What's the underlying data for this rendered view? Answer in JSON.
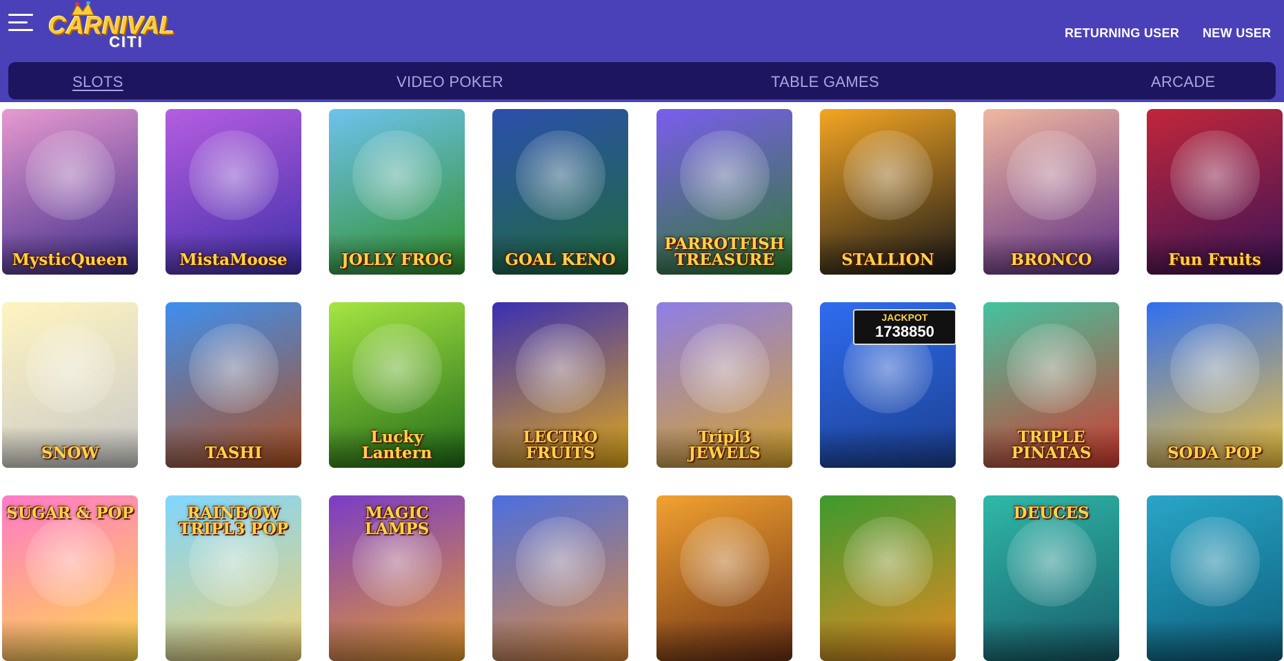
{
  "header": {
    "logo_line1": "CARNIVAL",
    "logo_line2": "CITI",
    "returning_user": "RETURNING USER",
    "new_user": "NEW USER",
    "menu_icon": "hamburger-menu-icon"
  },
  "nav": {
    "tabs": [
      {
        "label": "SLOTS",
        "active": true
      },
      {
        "label": "VIDEO POKER",
        "active": false
      },
      {
        "label": "TABLE GAMES",
        "active": false
      },
      {
        "label": "ARCADE",
        "active": false
      }
    ]
  },
  "games": [
    {
      "title": "MysticQueen",
      "colors": [
        "#e89ad0",
        "#3b2a8a"
      ]
    },
    {
      "title": "MistaMoose",
      "colors": [
        "#b65de0",
        "#3f2fa8"
      ]
    },
    {
      "title": "JOLLY FROG",
      "colors": [
        "#6ec2ee",
        "#2f8f27"
      ]
    },
    {
      "title": "GOAL KENO",
      "colors": [
        "#2b4fae",
        "#1f6b39"
      ]
    },
    {
      "title": "PARROTFISH TREASURE",
      "colors": [
        "#7b5cf0",
        "#2e7d2c"
      ]
    },
    {
      "title": "STALLION",
      "colors": [
        "#f5a623",
        "#181818"
      ]
    },
    {
      "title": "BRONCO",
      "colors": [
        "#f0b8a0",
        "#5b2c86"
      ]
    },
    {
      "title": "Fun Fruits",
      "colors": [
        "#c2263a",
        "#3a1357"
      ]
    },
    {
      "title": "SNOW",
      "colors": [
        "#fff4c0",
        "#c9c9c9"
      ]
    },
    {
      "title": "TASHI",
      "colors": [
        "#3d8ff0",
        "#b1501d"
      ]
    },
    {
      "title": "Lucky Lantern",
      "colors": [
        "#a6e542",
        "#1f6a18"
      ]
    },
    {
      "title": "LECTRO FRUITS",
      "colors": [
        "#3a2fb3",
        "#e0a81a"
      ]
    },
    {
      "title": "Tripl3 JEWELS",
      "colors": [
        "#8d7ee6",
        "#d8a42a"
      ]
    },
    {
      "title": "1738850",
      "colors": [
        "#2f6cf0",
        "#1b3f8f"
      ],
      "jackpot_label": "JACKPOT"
    },
    {
      "title": "TRIPLE PINATAS",
      "colors": [
        "#43c3a0",
        "#d23a2e"
      ]
    },
    {
      "title": "SODA POP",
      "colors": [
        "#2f6ff0",
        "#f4c23a"
      ]
    },
    {
      "title": "SUGAR & POP",
      "colors": [
        "#ff7ac9",
        "#ffd84a"
      ]
    },
    {
      "title": "RAINBOW TRIPL3 POP",
      "colors": [
        "#7fd6ff",
        "#f0d070"
      ]
    },
    {
      "title": "MAGIC LAMPS",
      "colors": [
        "#7a3cc8",
        "#e59a2b"
      ]
    },
    {
      "title": "",
      "colors": [
        "#4b6ee0",
        "#e08a3a"
      ]
    },
    {
      "title": "",
      "colors": [
        "#f2a230",
        "#6b2f14"
      ]
    },
    {
      "title": "",
      "colors": [
        "#3c9a2e",
        "#e58a22"
      ]
    },
    {
      "title": "DEUCES",
      "colors": [
        "#2fb9a8",
        "#175b6a"
      ]
    },
    {
      "title": "",
      "colors": [
        "#29a6c8",
        "#0d5e7b"
      ]
    }
  ]
}
